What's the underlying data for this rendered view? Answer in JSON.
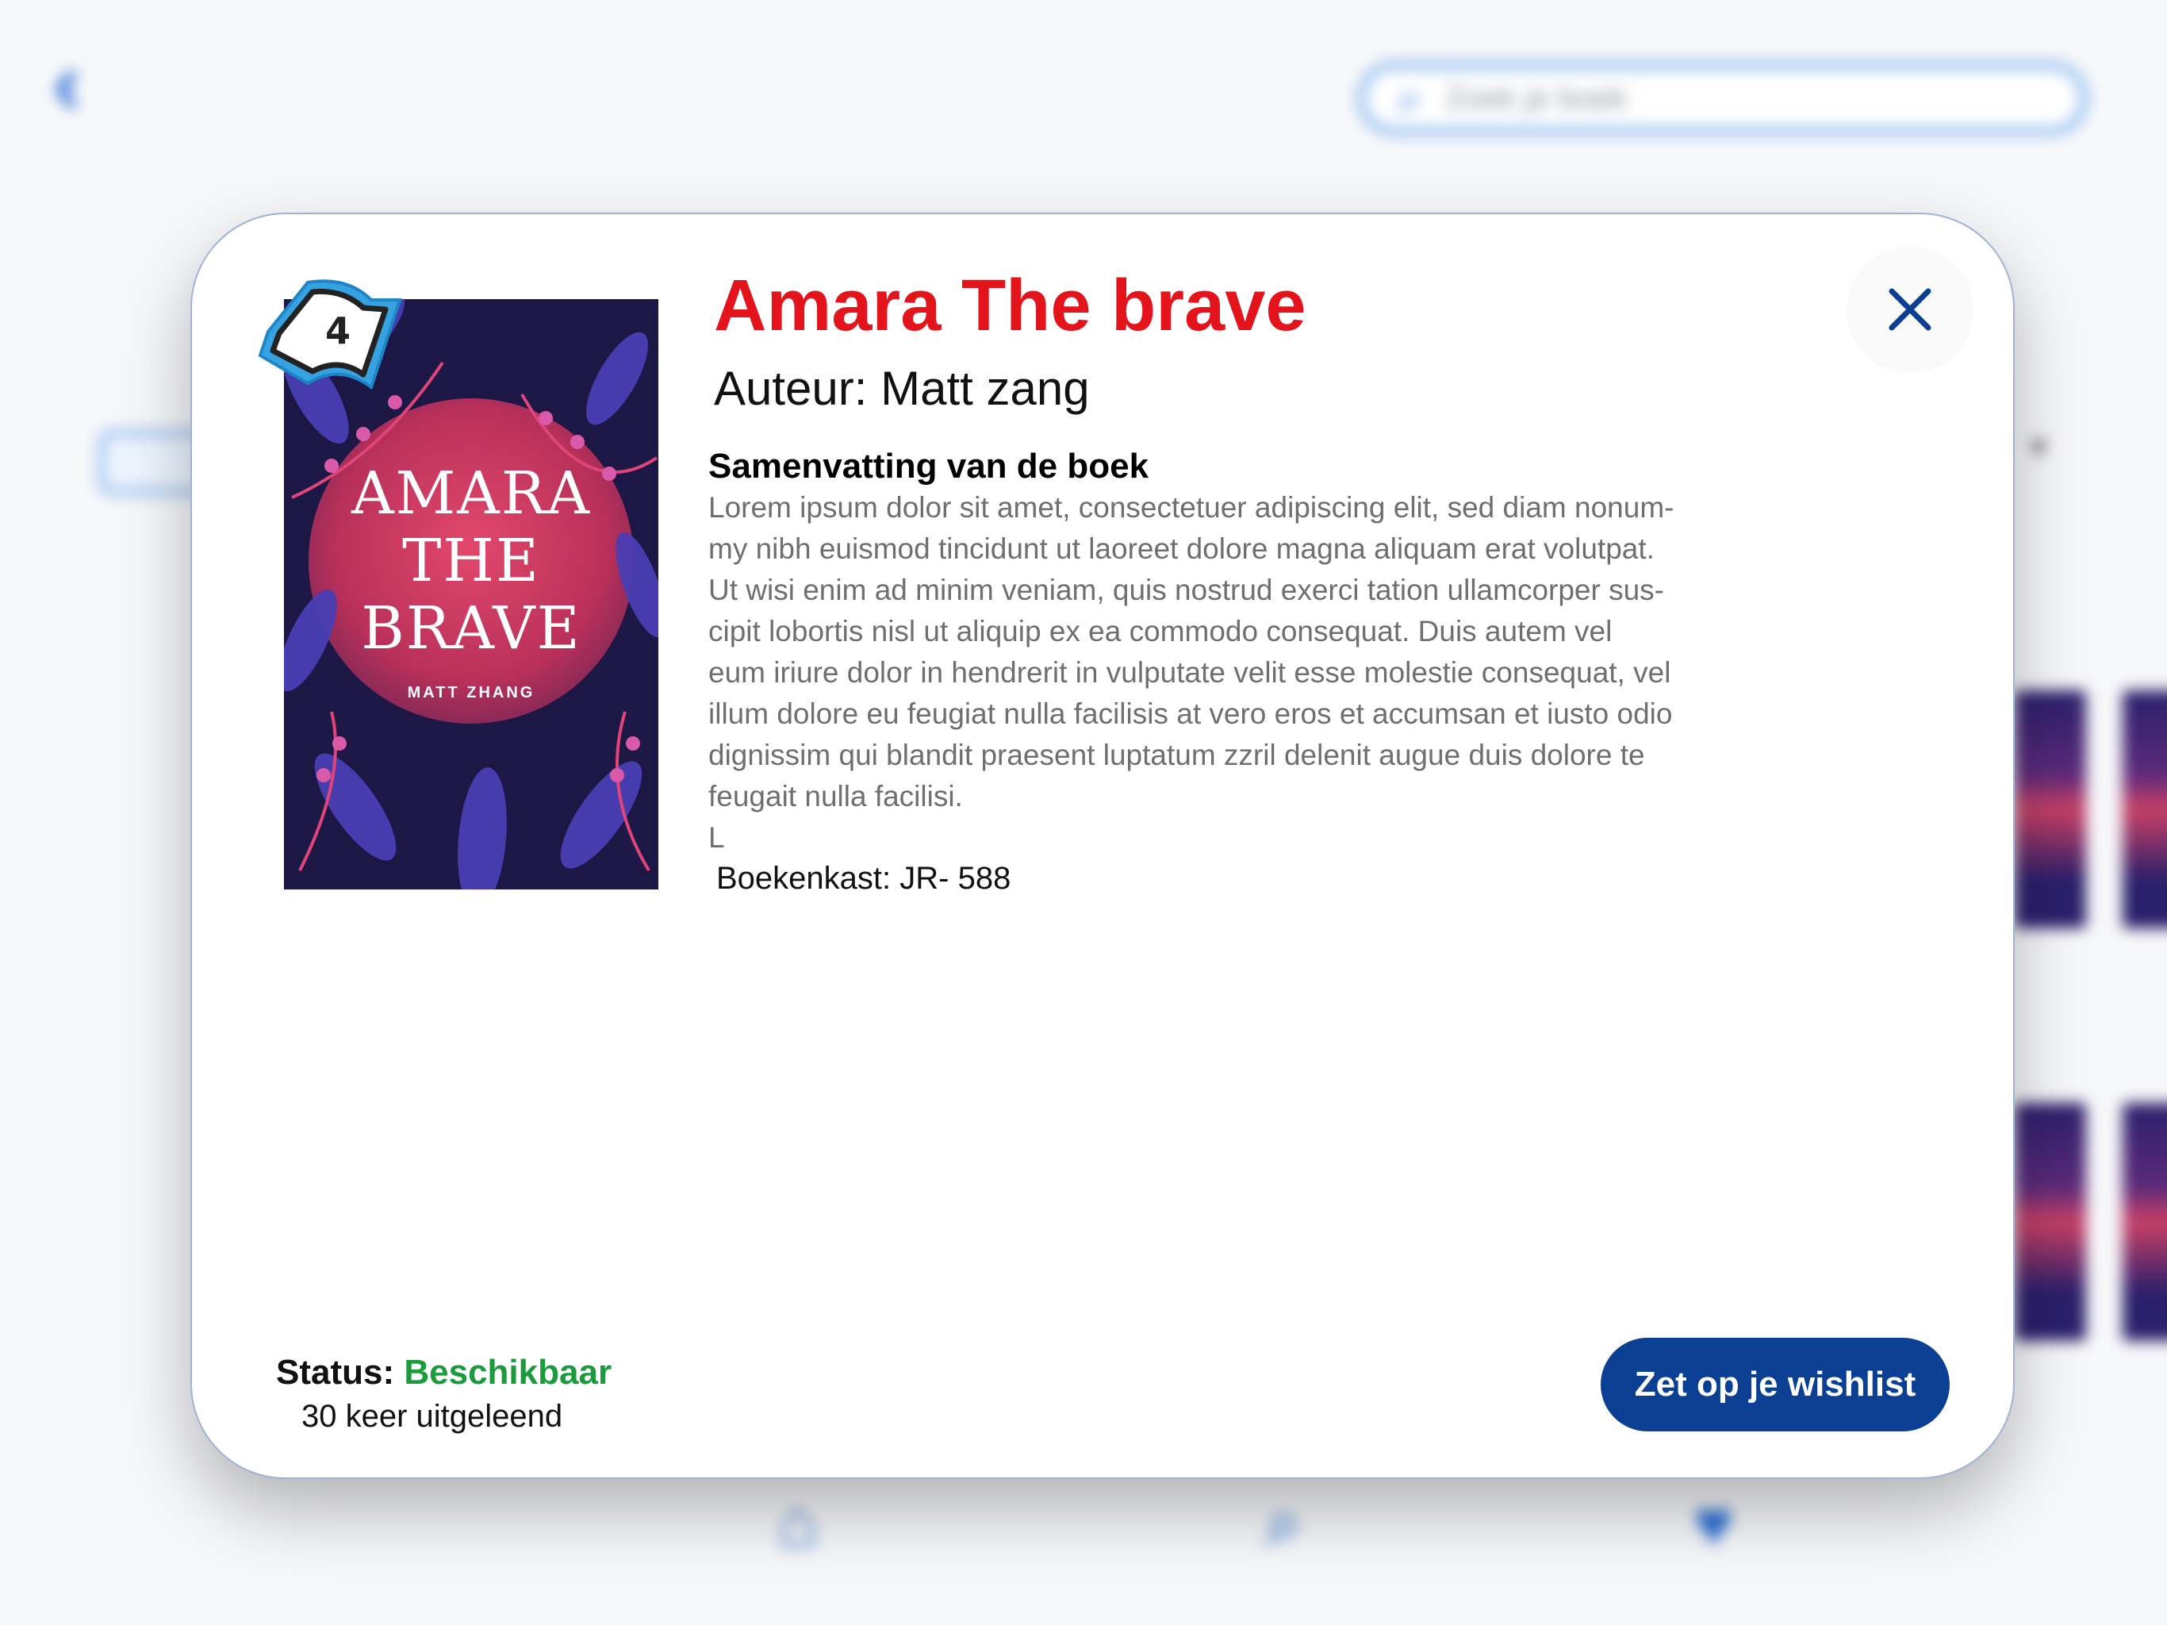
{
  "background": {
    "back_icon": "chevron-left-icon",
    "search_placeholder": "Zoek je boek",
    "nav_icons": [
      "home-icon",
      "search-icon",
      "heart-icon"
    ]
  },
  "modal": {
    "close_icon": "close-icon",
    "reading_level": "4",
    "cover": {
      "title_lines": [
        "AMARA",
        "THE",
        "BRAVE"
      ],
      "author": "MATT ZHANG"
    },
    "title": "Amara The brave",
    "author_line": "Auteur: Matt zang",
    "summary_heading": "Samenvatting van de boek",
    "summary_text": "Lorem ipsum dolor sit amet, consectetuer adipiscing elit, sed diam nonum-\nmy nibh euismod tincidunt ut laoreet dolore magna aliquam erat volutpat.\nUt wisi enim ad minim veniam, quis nostrud exerci tation ullamcorper sus-\ncipit lobortis nisl ut aliquip ex ea commodo consequat. Duis autem vel\neum iriure dolor in hendrerit in vulputate velit esse molestie consequat, vel\nillum dolore eu feugiat nulla facilisis at vero eros et accumsan et iusto odio\ndignissim qui blandit praesent luptatum zzril delenit augue duis dolore te\nfeugait nulla facilisi.\nL",
    "bookcase": "Boekenkast: JR- 588",
    "status_label": "Status:",
    "status_value": "Beschikbaar",
    "loans": "30 keer uitgeleend",
    "wishlist_button": "Zet op je wishlist",
    "colors": {
      "title": "#e3141b",
      "status_available": "#1c9b3c",
      "primary_button": "#0b3f93",
      "close_icon": "#0b3f93"
    }
  }
}
